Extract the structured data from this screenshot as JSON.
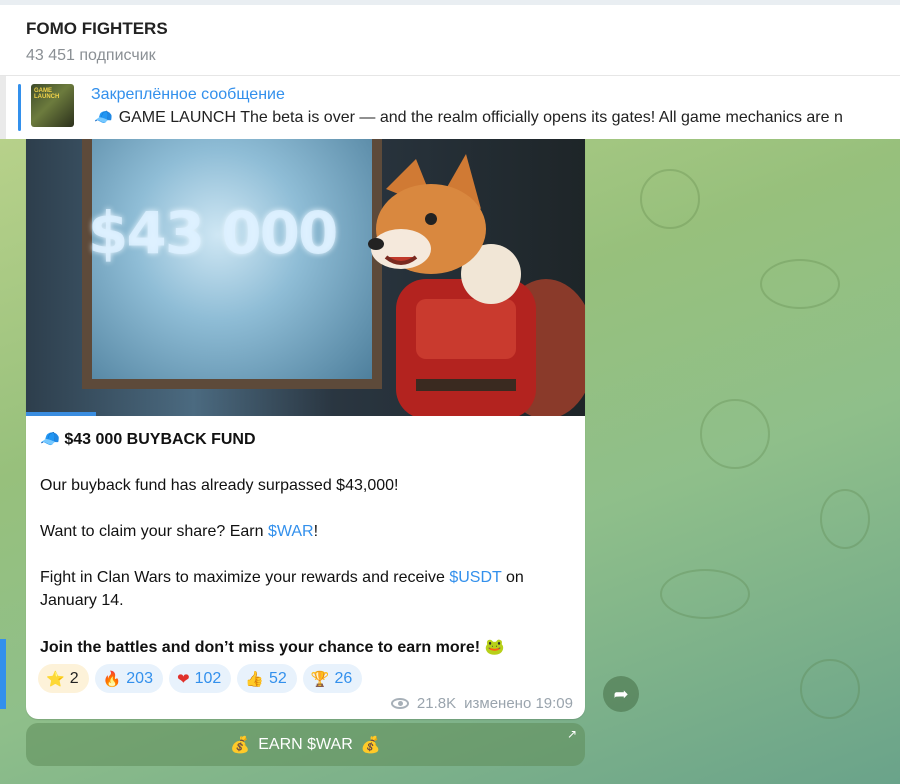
{
  "header": {
    "title": "FOMO FIGHTERS",
    "subtitle": "43 451 подписчик"
  },
  "pinned": {
    "label": "Закреплённое сообщение",
    "thumb_text": "GAME LAUNCH",
    "text": "GAME LAUNCH  The beta is over — and the realm officially opens its gates!  All game mechanics are n"
  },
  "post": {
    "image_text": "$43 000",
    "heading": "$43 000 BUYBACK FUND",
    "line1": "Our buyback fund has already surpassed $43,000!",
    "line2_pre": "Want to claim your share? Earn ",
    "line2_link": "$WAR",
    "line2_post": "!",
    "line3_pre": "Fight in Clan Wars to maximize your rewards and receive ",
    "line3_link": "$USDT",
    "line3_post": " on January 14.",
    "line4": "Join the battles and don’t miss your chance to earn more!",
    "reactions": [
      {
        "icon": "star-icon",
        "glyph": "⭐",
        "count": "2"
      },
      {
        "icon": "fire-icon",
        "glyph": "🔥",
        "count": "203"
      },
      {
        "icon": "heart-icon",
        "glyph": "❤",
        "count": "102"
      },
      {
        "icon": "thumbs-up-icon",
        "glyph": "👍",
        "count": "52"
      },
      {
        "icon": "trophy-icon",
        "glyph": "🏆",
        "count": "26"
      }
    ],
    "views": "21.8K",
    "edited": "изменено 19:09"
  },
  "button": {
    "label": "EARN $WAR",
    "emoji": "💰"
  },
  "colors": {
    "accent": "#3390ec",
    "reaction_bg": "#e8f2fc"
  }
}
